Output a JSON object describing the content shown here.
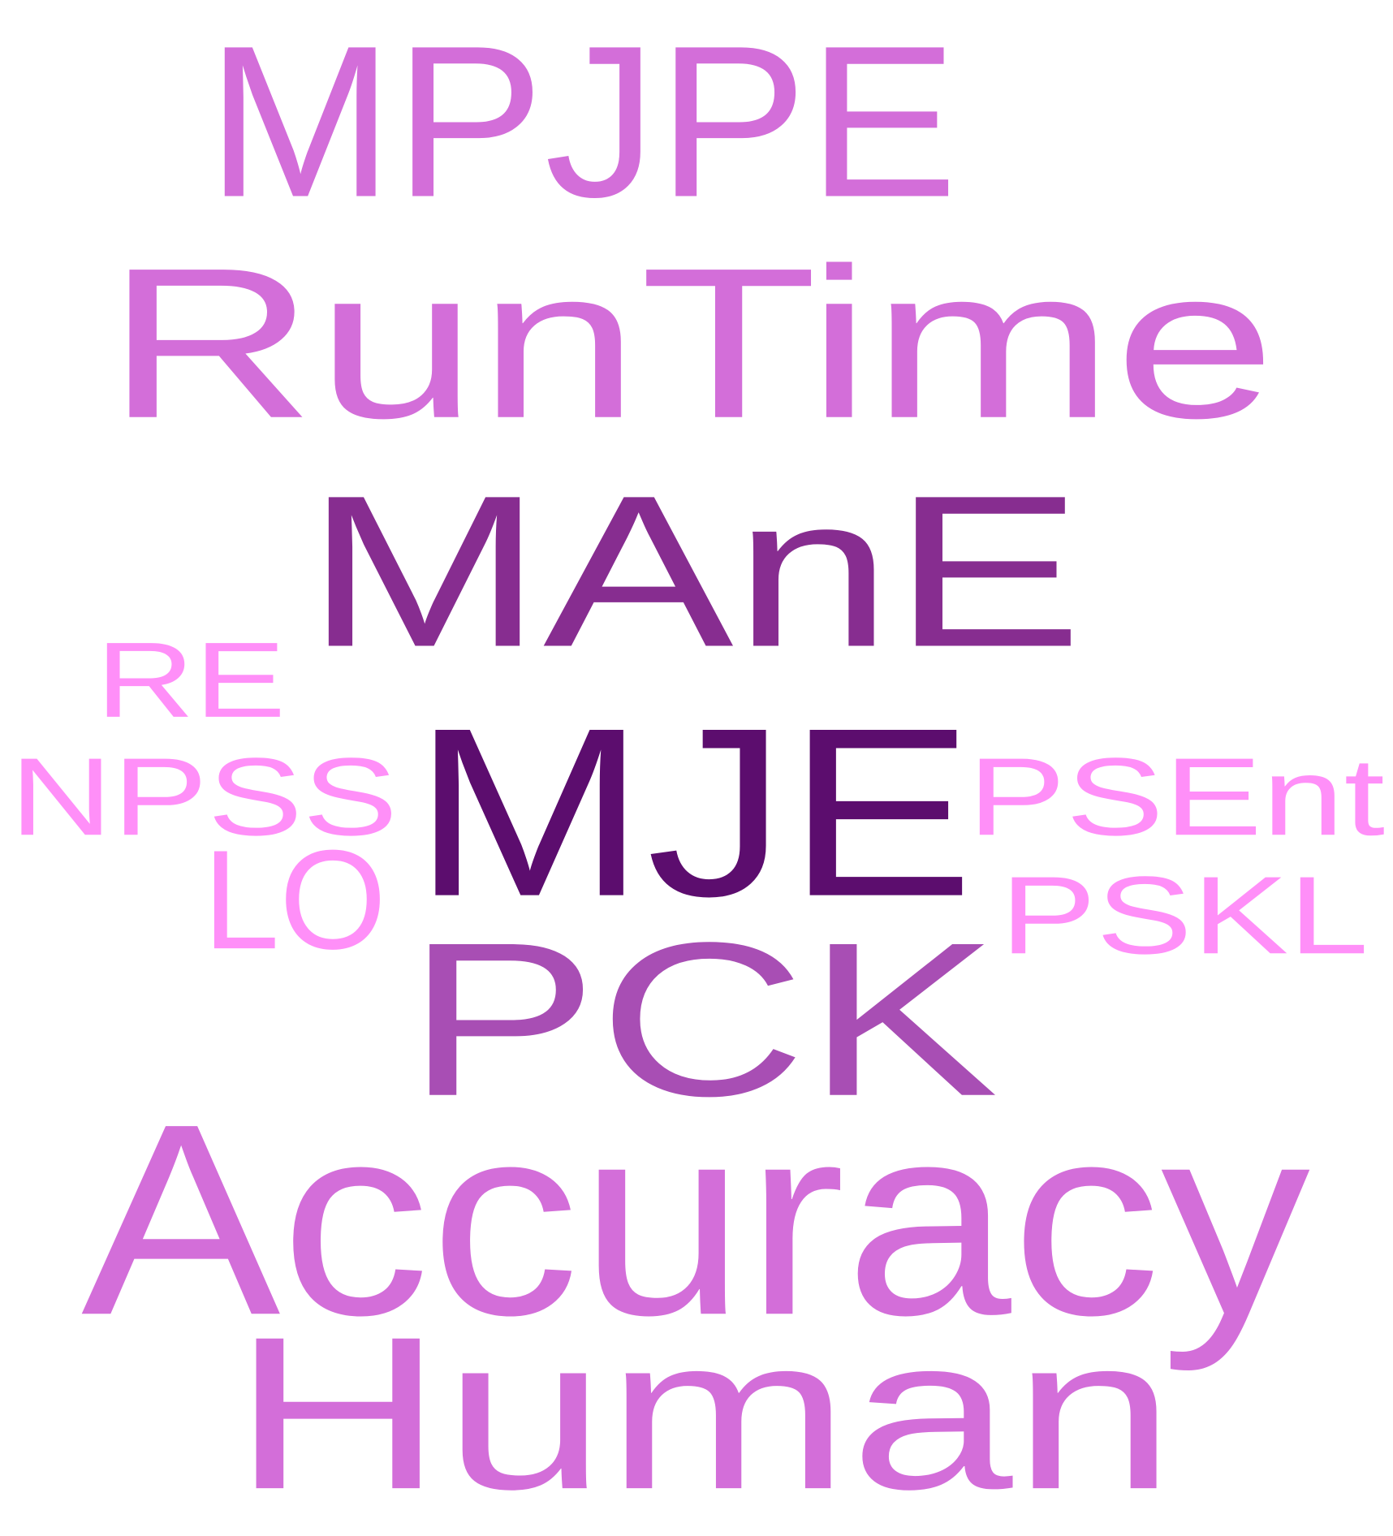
{
  "palette": {
    "background": "#ffffff",
    "orchid": "#d36ed9",
    "plum_dark": "#5c0d6e",
    "plum": "#872d90",
    "violet": "#a84eb4",
    "pink_light": "#ff8ff8"
  },
  "words": [
    {
      "text": "MPJPE",
      "color": "#d36ed9"
    },
    {
      "text": "RunTime",
      "color": "#d36ed9"
    },
    {
      "text": "MAnE",
      "color": "#872d90"
    },
    {
      "text": "RE",
      "color": "#ff8ff8"
    },
    {
      "text": "NPSS",
      "color": "#ff8ff8"
    },
    {
      "text": "MJE",
      "color": "#5c0d6e"
    },
    {
      "text": "PSEnt",
      "color": "#ff8ff8"
    },
    {
      "text": "LO",
      "color": "#ff8ff8"
    },
    {
      "text": "PSKL",
      "color": "#ff8ff8"
    },
    {
      "text": "PCK",
      "color": "#a84eb4"
    },
    {
      "text": "Accuracy",
      "color": "#d36ed9"
    },
    {
      "text": "Human",
      "color": "#d36ed9"
    }
  ]
}
